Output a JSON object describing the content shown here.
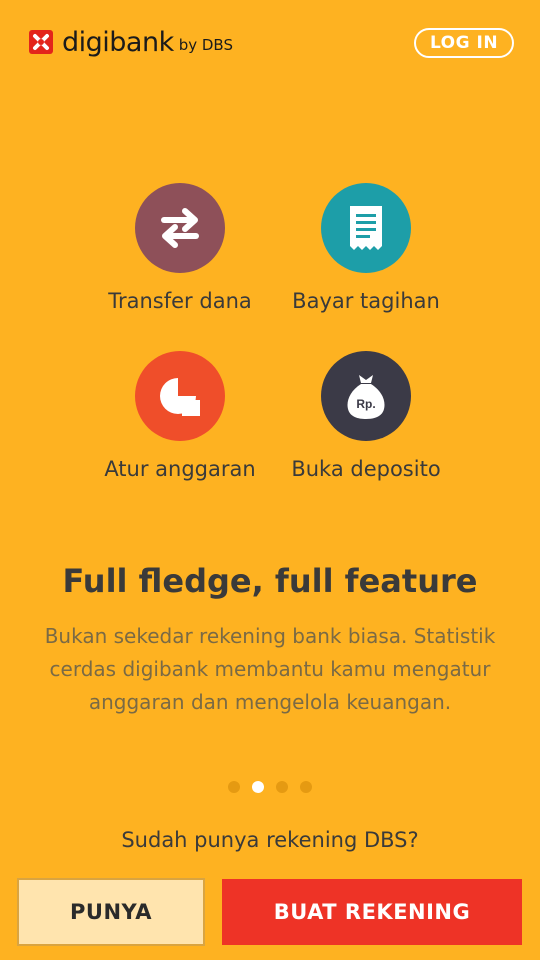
{
  "header": {
    "logo_text": "digibank",
    "logo_suffix": "by DBS",
    "login_label": "LOG IN"
  },
  "features": [
    {
      "label": "Transfer dana",
      "icon": "transfer-arrows-icon",
      "color": "#8E5059"
    },
    {
      "label": "Bayar tagihan",
      "icon": "receipt-icon",
      "color": "#1D9EA8"
    },
    {
      "label": "Atur anggaran",
      "icon": "pie-chart-icon",
      "color": "#EF4E2A"
    },
    {
      "label": "Buka deposito",
      "icon": "money-bag-icon",
      "color": "#3B3A47"
    }
  ],
  "deposit_icon_text": "Rp.",
  "headline": "Full fledge, full feature",
  "description": "Bukan sekedar rekening bank biasa. Statistik cerdas digibank membantu kamu mengatur anggaran dan mengelola keuangan.",
  "pagination": {
    "total": 4,
    "active": 2
  },
  "question": "Sudah punya rekening DBS?",
  "buttons": {
    "have_account": "PUNYA",
    "create_account": "BUAT REKENING"
  },
  "colors": {
    "background": "#FEB221",
    "primary_button": "#EE3326",
    "secondary_button": "#FFE4AE"
  }
}
